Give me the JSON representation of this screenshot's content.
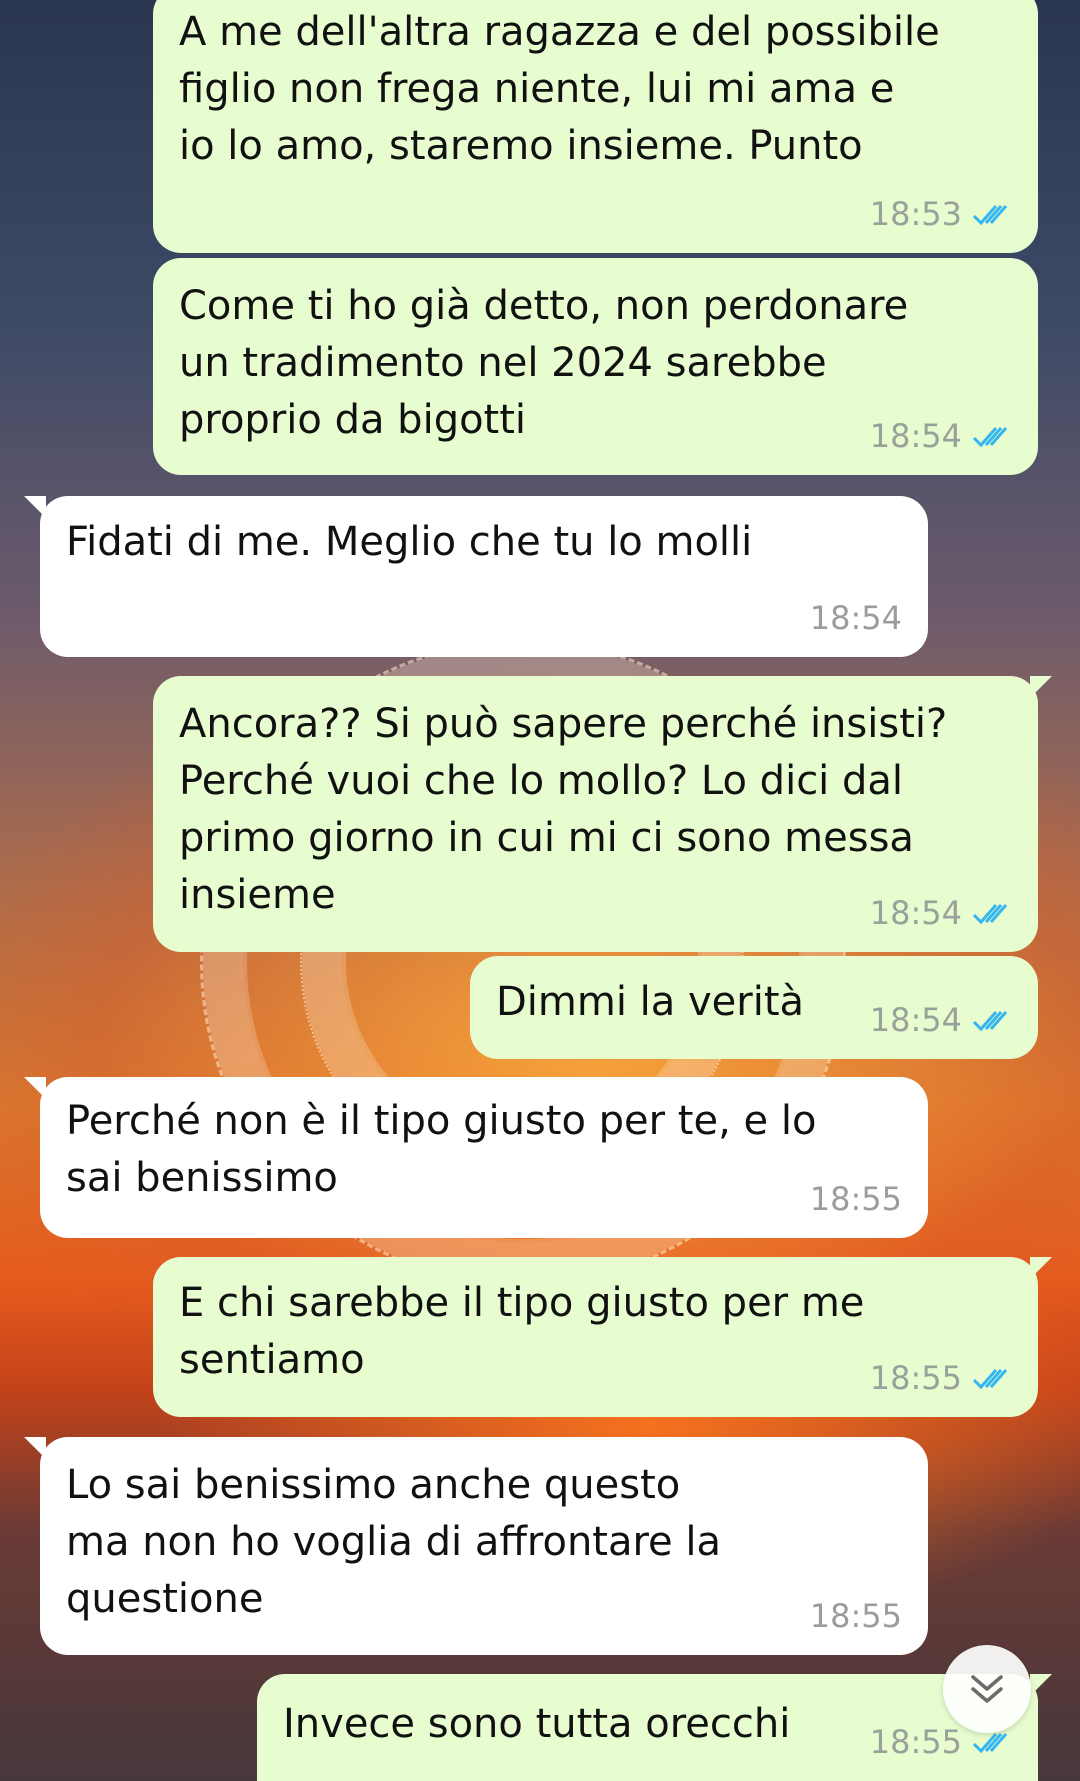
{
  "messages": [
    {
      "direction": "out",
      "text": "A me dell'altra ragazza e del possibile\nfiglio non frega niente, lui mi ama e\nio lo amo, staremo insieme. Punto",
      "time": "18:53",
      "status": "read"
    },
    {
      "direction": "out",
      "text": "Come ti ho già detto, non perdonare\nun tradimento nel 2024 sarebbe\nproprio da bigotti",
      "time": "18:54",
      "status": "read"
    },
    {
      "direction": "in",
      "text": "Fidati di me. Meglio che tu lo molli",
      "time": "18:54"
    },
    {
      "direction": "out",
      "text": "Ancora?? Si può sapere perché insisti?\nPerché vuoi che lo mollo? Lo dici dal\nprimo giorno in cui mi ci sono messa\ninsieme",
      "time": "18:54",
      "status": "read"
    },
    {
      "direction": "out",
      "text": "Dimmi la verità",
      "time": "18:54",
      "status": "read"
    },
    {
      "direction": "in",
      "text": "Perché non è il tipo giusto per te, e lo\nsai benissimo",
      "time": "18:55"
    },
    {
      "direction": "out",
      "text": "E chi sarebbe il tipo giusto per me\nsentiamo",
      "time": "18:55",
      "status": "read"
    },
    {
      "direction": "in",
      "text": "Lo sai benissimo anche questo\nma non ho voglia di affrontare la\nquestione",
      "time": "18:55"
    },
    {
      "direction": "out",
      "text": "Invece sono tutta orecchi",
      "time": "18:55",
      "status": "read"
    }
  ],
  "colors": {
    "outgoing_bubble": "#e7fccf",
    "incoming_bubble": "#ffffff",
    "read_ticks": "#34b7f1",
    "time_text": "#9aa19a"
  },
  "icons": {
    "read_status": "double-check-icon",
    "scroll_down": "chevron-double-down-icon"
  }
}
